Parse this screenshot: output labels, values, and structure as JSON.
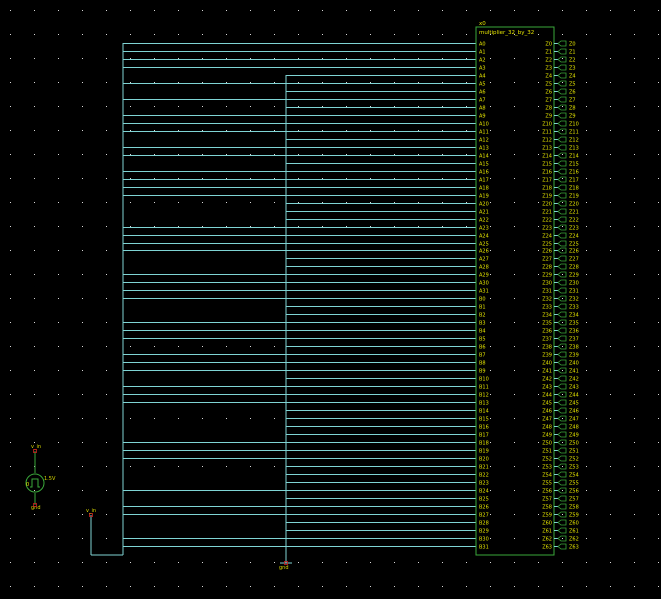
{
  "background": "#000000",
  "colors": {
    "wire": "#7fd4d4",
    "component": "#3aa83a",
    "text": "#e6e600",
    "pin_marker": "#cc2222",
    "grid": "#d8d8d8"
  },
  "block": {
    "instance": "x0",
    "type": "multiplier_32_by_32",
    "inputs": [
      "A0",
      "A1",
      "A2",
      "A3",
      "A4",
      "A5",
      "A6",
      "A7",
      "A8",
      "A9",
      "A10",
      "A11",
      "A12",
      "A13",
      "A14",
      "A15",
      "A16",
      "A17",
      "A18",
      "A19",
      "A20",
      "A21",
      "A22",
      "A23",
      "A24",
      "A25",
      "A26",
      "A27",
      "A28",
      "A29",
      "A30",
      "A31",
      "B0",
      "B1",
      "B2",
      "B3",
      "B4",
      "B5",
      "B6",
      "B7",
      "B8",
      "B9",
      "B10",
      "B11",
      "B12",
      "B13",
      "B14",
      "B15",
      "B16",
      "B17",
      "B18",
      "B19",
      "B20",
      "B21",
      "B22",
      "B23",
      "B24",
      "B25",
      "B26",
      "B27",
      "B28",
      "B29",
      "B30",
      "B31"
    ],
    "outputs": [
      "Z0",
      "Z1",
      "Z2",
      "Z3",
      "Z4",
      "Z5",
      "Z6",
      "Z7",
      "Z8",
      "Z9",
      "Z10",
      "Z11",
      "Z12",
      "Z13",
      "Z14",
      "Z15",
      "Z16",
      "Z17",
      "Z18",
      "Z19",
      "Z20",
      "Z21",
      "Z22",
      "Z23",
      "Z24",
      "Z25",
      "Z26",
      "Z27",
      "Z28",
      "Z29",
      "Z30",
      "Z31",
      "Z32",
      "Z33",
      "Z34",
      "Z35",
      "Z36",
      "Z37",
      "Z38",
      "Z39",
      "Z40",
      "Z41",
      "Z42",
      "Z43",
      "Z44",
      "Z45",
      "Z46",
      "Z47",
      "Z48",
      "Z49",
      "Z50",
      "Z51",
      "Z52",
      "Z53",
      "Z54",
      "Z55",
      "Z56",
      "Z57",
      "Z58",
      "Z59",
      "Z60",
      "Z61",
      "Z62",
      "Z63"
    ]
  },
  "input_connections": [
    1,
    1,
    1,
    1,
    0,
    1,
    0,
    1,
    0,
    1,
    1,
    1,
    0,
    1,
    1,
    0,
    1,
    1,
    1,
    1,
    0,
    0,
    0,
    1,
    1,
    1,
    1,
    0,
    0,
    1,
    1,
    1,
    1,
    0,
    0,
    1,
    1,
    1,
    0,
    1,
    1,
    1,
    0,
    1,
    1,
    1,
    0,
    0,
    0,
    0,
    1,
    1,
    1,
    0,
    0,
    0,
    1,
    0,
    1,
    1,
    0,
    0,
    1,
    1
  ],
  "source": {
    "label_top": "v_in",
    "label_right": "1.5V",
    "label_bottom": "gnd"
  },
  "net_labels": {
    "vin": "v_in",
    "gnd": "gnd"
  }
}
